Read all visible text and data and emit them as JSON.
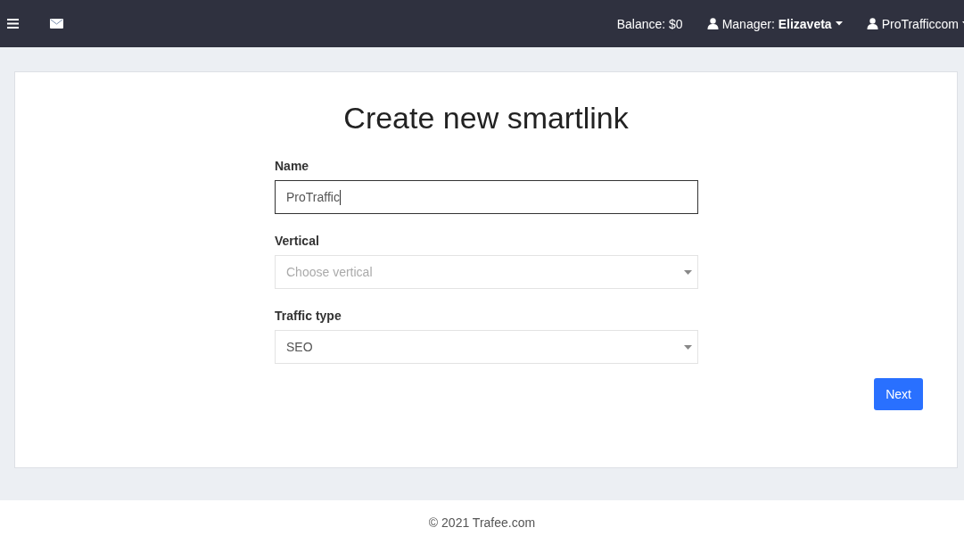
{
  "navbar": {
    "balance": "Balance: $0",
    "manager": "Manager: **Elizaveta**",
    "account": "ProTrafficcom"
  },
  "form": {
    "title": "Create new smartlink",
    "fields": [
      {
        "label": "Name",
        "kind": "input",
        "value": "ProTraffic",
        "focused": true
      },
      {
        "label": "Vertical",
        "kind": "select",
        "placeholder": "Choose vertical"
      },
      {
        "label": "Traffic type",
        "kind": "select",
        "value": "SEO"
      }
    ],
    "submit": "Next"
  },
  "footer": "© 2021 Trafee.com"
}
